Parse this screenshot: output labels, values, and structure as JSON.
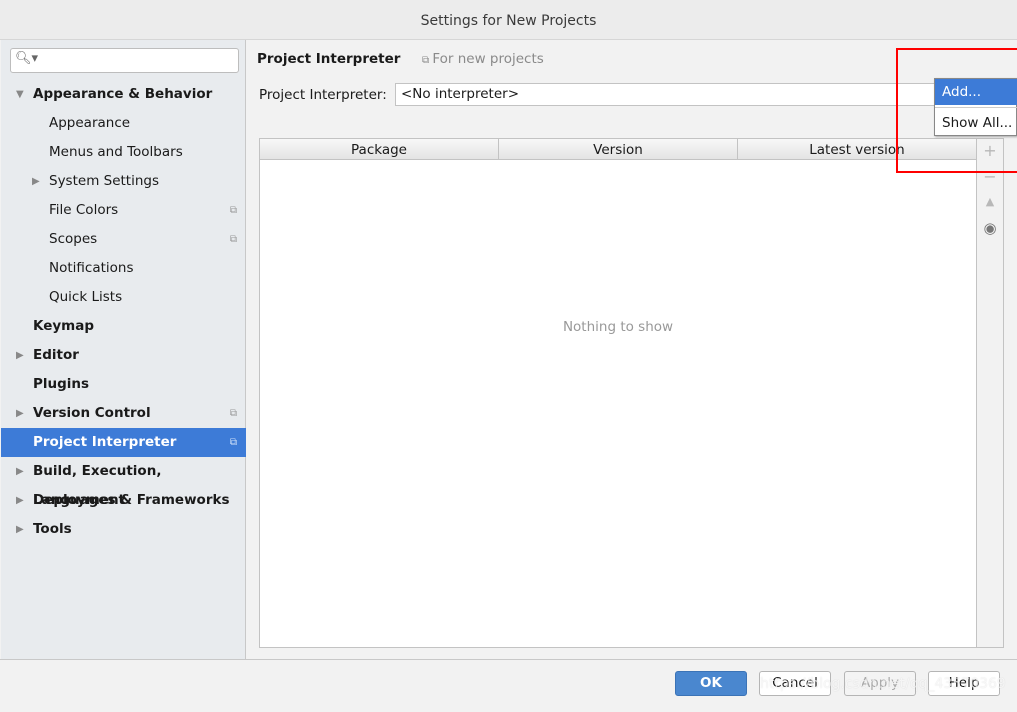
{
  "window": {
    "title": "Settings for New Projects"
  },
  "sidebar": {
    "search_placeholder": "",
    "items": [
      {
        "label": "Appearance & Behavior",
        "bold": true,
        "expanded": true
      },
      {
        "label": "Appearance"
      },
      {
        "label": "Menus and Toolbars"
      },
      {
        "label": "System Settings",
        "collapsed": true
      },
      {
        "label": "File Colors",
        "copy_icon": true
      },
      {
        "label": "Scopes",
        "copy_icon": true
      },
      {
        "label": "Notifications"
      },
      {
        "label": "Quick Lists"
      },
      {
        "label": "Keymap",
        "bold": true
      },
      {
        "label": "Editor",
        "bold": true,
        "collapsed": true
      },
      {
        "label": "Plugins",
        "bold": true
      },
      {
        "label": "Version Control",
        "bold": true,
        "collapsed": true,
        "copy_icon": true
      },
      {
        "label": "Project Interpreter",
        "bold": true,
        "selected": true,
        "copy_icon": true
      },
      {
        "label": "Build, Execution, Deployment",
        "bold": true,
        "collapsed": true
      },
      {
        "label": "Languages & Frameworks",
        "bold": true,
        "collapsed": true
      },
      {
        "label": "Tools",
        "bold": true,
        "collapsed": true
      }
    ]
  },
  "main": {
    "title": "Project Interpreter",
    "scope": "For new projects",
    "interpreter_label": "Project Interpreter:",
    "interpreter_value": "<No interpreter>",
    "table": {
      "columns": [
        "Package",
        "Version",
        "Latest version"
      ],
      "empty_text": "Nothing to show"
    }
  },
  "popup": {
    "items": [
      "Add...",
      "Show All..."
    ],
    "highlighted": 0
  },
  "footer": {
    "ok": "OK",
    "cancel": "Cancel",
    "apply": "Apply",
    "help": "Help"
  },
  "watermark": "https://blog.csdn.net/qq_43570369",
  "colors": {
    "selection": "#3d7bd7",
    "ok_button": "#4a87cf",
    "annotation_box": "#ff0000"
  }
}
